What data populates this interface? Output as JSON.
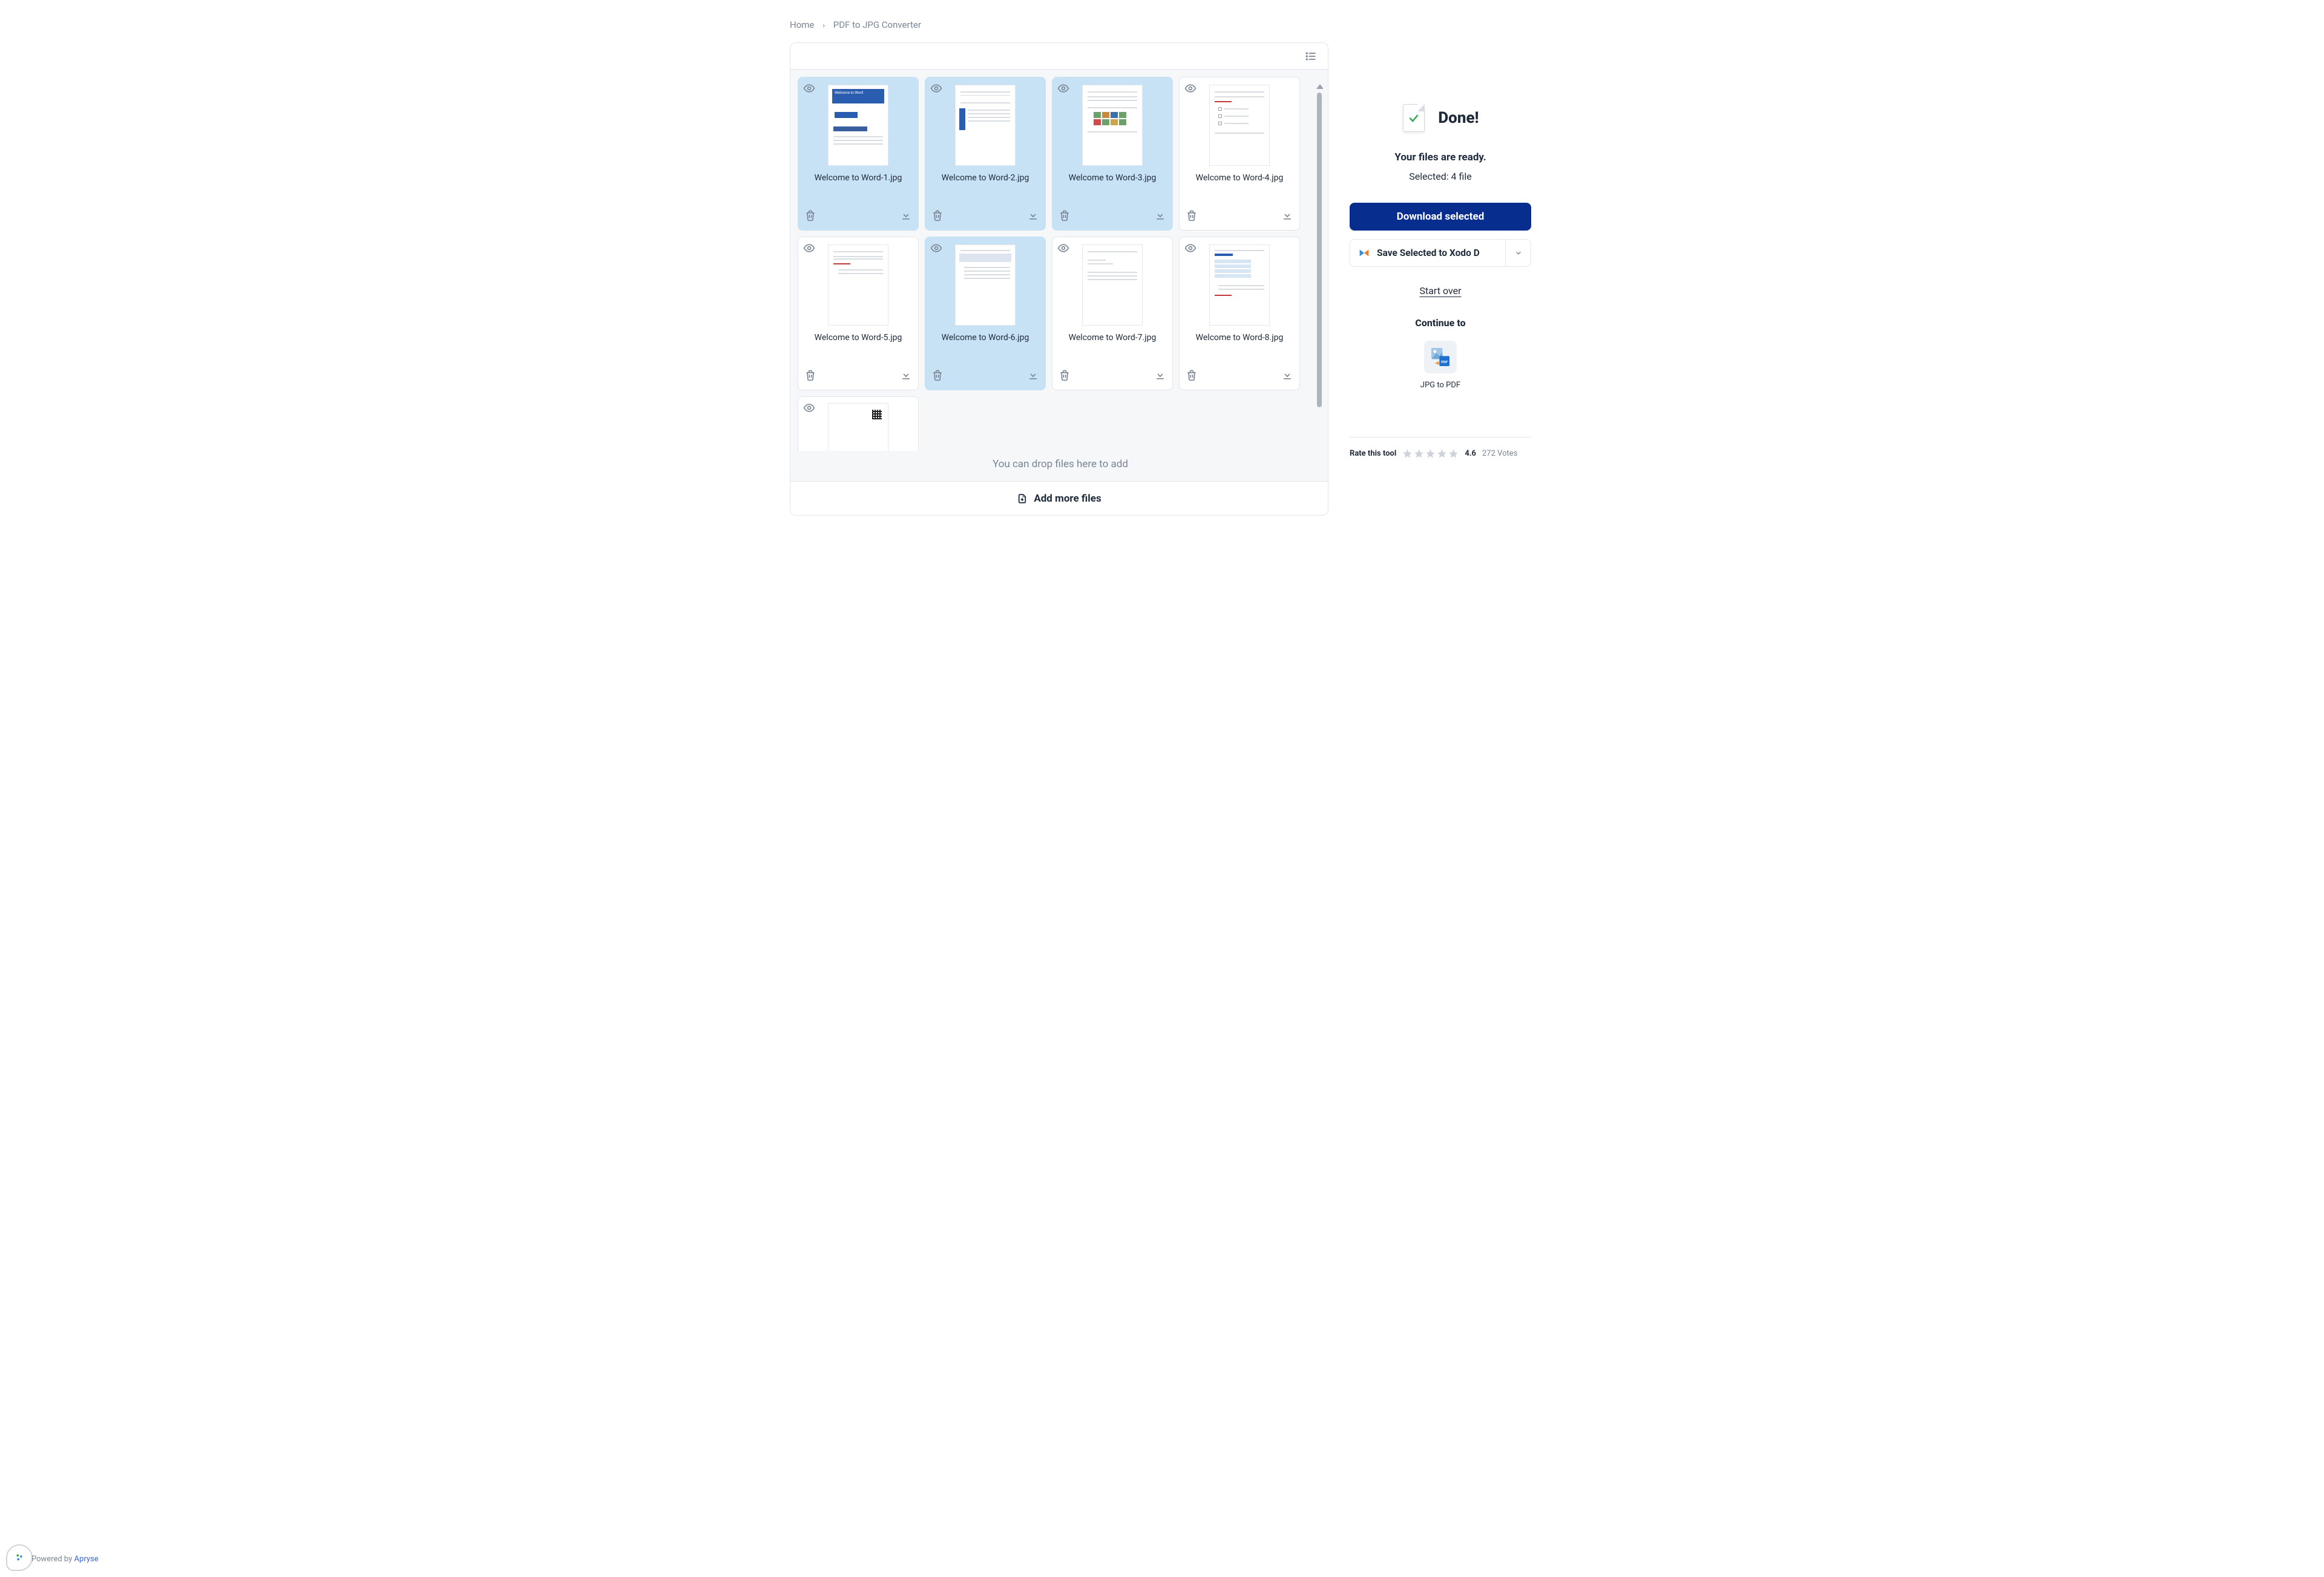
{
  "breadcrumb": {
    "home": "Home",
    "current": "PDF to JPG Converter"
  },
  "files": [
    {
      "name": "Welcome to Word-1.jpg",
      "selected": true
    },
    {
      "name": "Welcome to Word-2.jpg",
      "selected": true
    },
    {
      "name": "Welcome to Word-3.jpg",
      "selected": true
    },
    {
      "name": "Welcome to Word-4.jpg",
      "selected": false
    },
    {
      "name": "Welcome to Word-5.jpg",
      "selected": false
    },
    {
      "name": "Welcome to Word-6.jpg",
      "selected": true
    },
    {
      "name": "Welcome to Word-7.jpg",
      "selected": false
    },
    {
      "name": "Welcome to Word-8.jpg",
      "selected": false
    },
    {
      "name": "",
      "selected": false,
      "partial": true
    }
  ],
  "drop_text": "You can drop files here to add",
  "add_more": "Add more files",
  "right": {
    "done": "Done!",
    "ready": "Your files are ready.",
    "selected": "Selected: 4 file",
    "download": "Download selected",
    "save": "Save Selected to Xodo D",
    "start_over": "Start over",
    "continue": "Continue to",
    "tool_label": "JPG to PDF"
  },
  "rating": {
    "label": "Rate this tool",
    "score": "4.6",
    "votes": "272 Votes"
  },
  "footer": {
    "powered": "Powered by ",
    "brand": "Apryse"
  }
}
